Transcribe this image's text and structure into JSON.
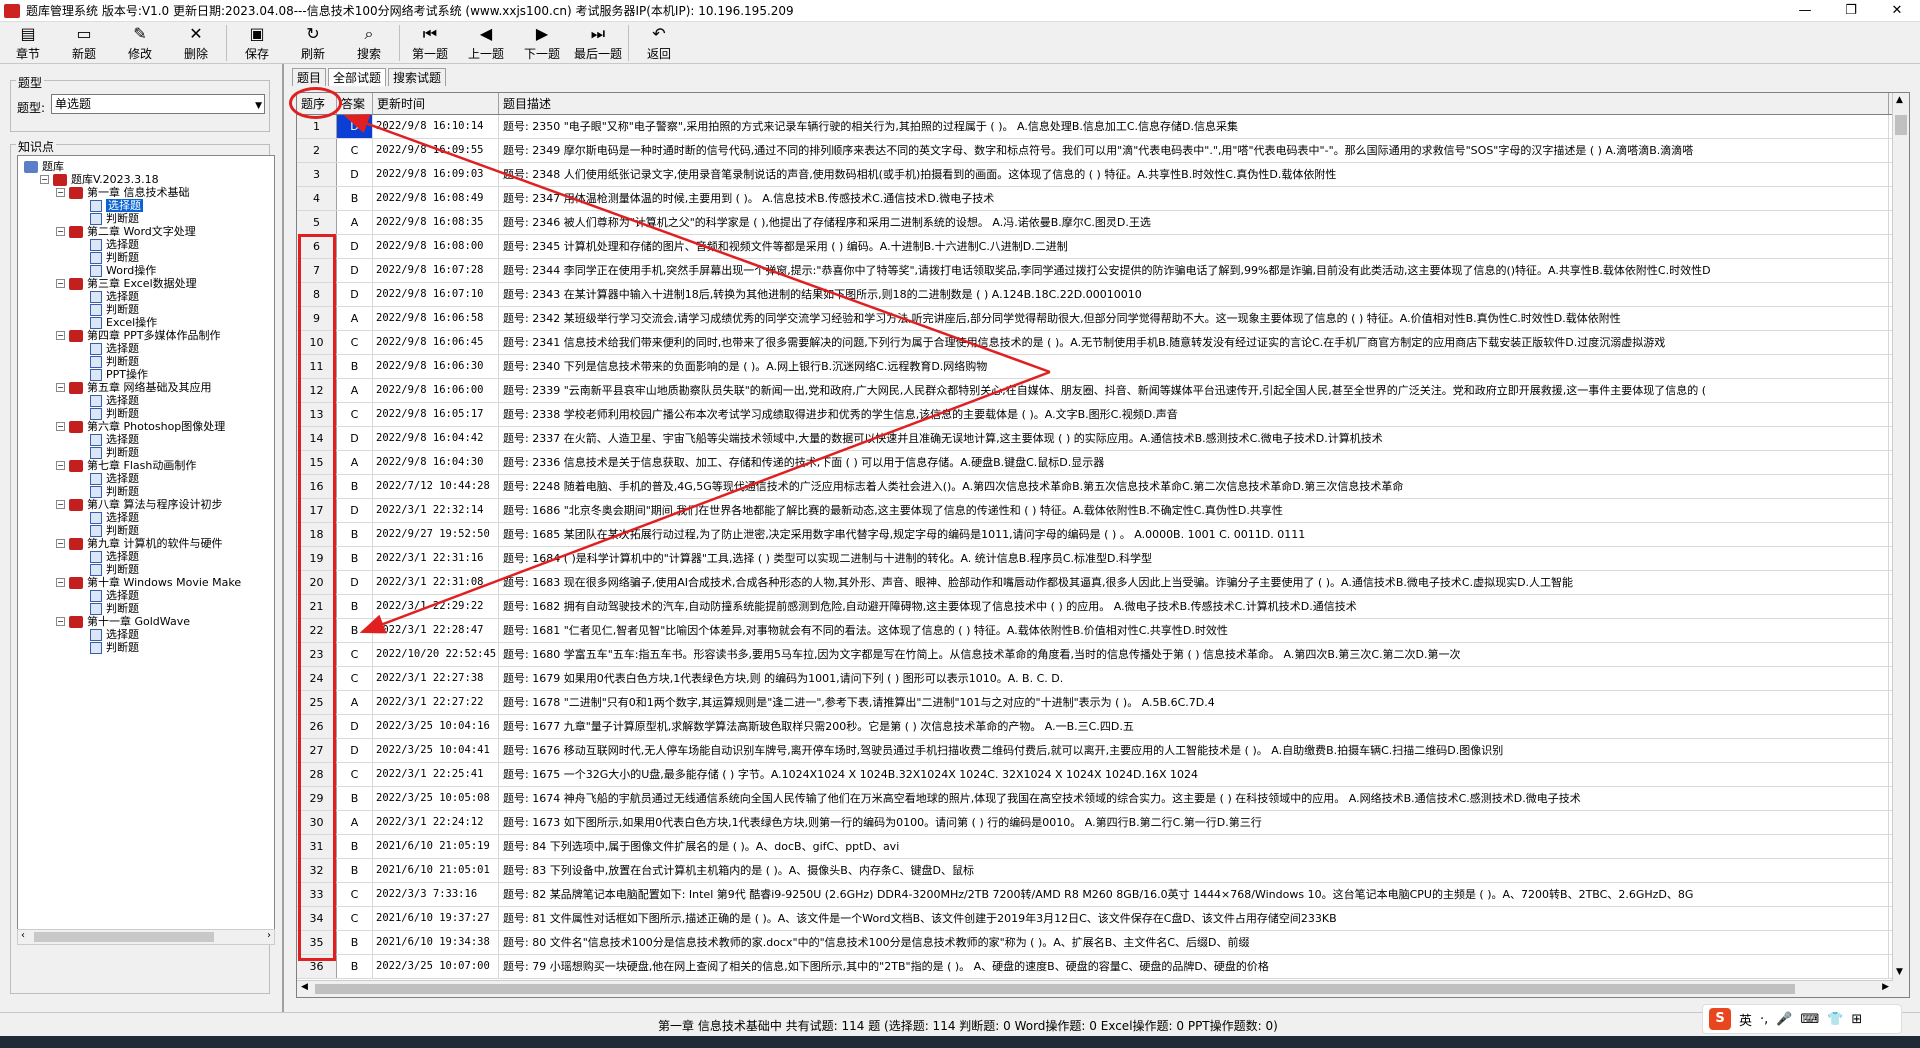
{
  "window": {
    "title": "题库管理系统 版本号:V1.0 更新日期:2023.04.08---信息技术100分网络考试系统    (www.xxjs100.cn)          考试服务器IP(本机IP): 10.196.195.209",
    "controls": [
      "—",
      "❐",
      "✕"
    ]
  },
  "toolbar": [
    {
      "label": "章节",
      "icon": "▤"
    },
    {
      "label": "新题",
      "icon": "▭"
    },
    {
      "label": "修改",
      "icon": "✎"
    },
    {
      "label": "删除",
      "icon": "✕"
    },
    {
      "label": "保存",
      "icon": "▣"
    },
    {
      "label": "刷新",
      "icon": "↻"
    },
    {
      "label": "搜索",
      "icon": "⌕"
    },
    {
      "label": "第一题",
      "icon": "⏮"
    },
    {
      "label": "上一题",
      "icon": "◀"
    },
    {
      "label": "下一题",
      "icon": "▶"
    },
    {
      "label": "最后一题",
      "icon": "⏭"
    },
    {
      "label": "返回",
      "icon": "↶"
    }
  ],
  "left": {
    "type_group": "题型",
    "type_label": "题型:",
    "type_value": "单选题",
    "kp_group": "知识点",
    "tree": [
      {
        "label": "题库",
        "level": 0,
        "kind": "root"
      },
      {
        "label": "题库V.2023.3.18",
        "level": 1,
        "kind": "book"
      },
      {
        "label": "第一章 信息技术基础",
        "level": 2,
        "kind": "book"
      },
      {
        "label": "选择题",
        "level": 3,
        "kind": "grid",
        "selected": true
      },
      {
        "label": "判断题",
        "level": 3,
        "kind": "grid"
      },
      {
        "label": "第二章 Word文字处理",
        "level": 2,
        "kind": "book"
      },
      {
        "label": "选择题",
        "level": 3,
        "kind": "grid"
      },
      {
        "label": "判断题",
        "level": 3,
        "kind": "grid"
      },
      {
        "label": "Word操作",
        "level": 3,
        "kind": "grid"
      },
      {
        "label": "第三章 Excel数据处理",
        "level": 2,
        "kind": "book"
      },
      {
        "label": "选择题",
        "level": 3,
        "kind": "grid"
      },
      {
        "label": "判断题",
        "level": 3,
        "kind": "grid"
      },
      {
        "label": "Excel操作",
        "level": 3,
        "kind": "grid"
      },
      {
        "label": "第四章 PPT多媒体作品制作",
        "level": 2,
        "kind": "book"
      },
      {
        "label": "选择题",
        "level": 3,
        "kind": "grid"
      },
      {
        "label": "判断题",
        "level": 3,
        "kind": "grid"
      },
      {
        "label": "PPT操作",
        "level": 3,
        "kind": "grid"
      },
      {
        "label": "第五章 网络基础及其应用",
        "level": 2,
        "kind": "book"
      },
      {
        "label": "选择题",
        "level": 3,
        "kind": "grid"
      },
      {
        "label": "判断题",
        "level": 3,
        "kind": "grid"
      },
      {
        "label": "第六章 Photoshop图像处理",
        "level": 2,
        "kind": "book"
      },
      {
        "label": "选择题",
        "level": 3,
        "kind": "grid"
      },
      {
        "label": "判断题",
        "level": 3,
        "kind": "grid"
      },
      {
        "label": "第七章 Flash动画制作",
        "level": 2,
        "kind": "book"
      },
      {
        "label": "选择题",
        "level": 3,
        "kind": "grid"
      },
      {
        "label": "判断题",
        "level": 3,
        "kind": "grid"
      },
      {
        "label": "第八章 算法与程序设计初步",
        "level": 2,
        "kind": "book"
      },
      {
        "label": "选择题",
        "level": 3,
        "kind": "grid"
      },
      {
        "label": "判断题",
        "level": 3,
        "kind": "grid"
      },
      {
        "label": "第九章 计算机的软件与硬件",
        "level": 2,
        "kind": "book"
      },
      {
        "label": "选择题",
        "level": 3,
        "kind": "grid"
      },
      {
        "label": "判断题",
        "level": 3,
        "kind": "grid"
      },
      {
        "label": "第十章 Windows Movie Make",
        "level": 2,
        "kind": "book"
      },
      {
        "label": "选择题",
        "level": 3,
        "kind": "grid"
      },
      {
        "label": "判断题",
        "level": 3,
        "kind": "grid"
      },
      {
        "label": "第十一章 GoldWave",
        "level": 2,
        "kind": "book"
      },
      {
        "label": "选择题",
        "level": 3,
        "kind": "grid"
      },
      {
        "label": "判断题",
        "level": 3,
        "kind": "grid"
      }
    ]
  },
  "tabs": [
    "题目",
    "全部试题",
    "搜索试题"
  ],
  "grid": {
    "headers": [
      "题序",
      "答案",
      "更新时间",
      "题目描述"
    ],
    "rows": [
      [
        "1",
        "D",
        "2022/9/8 16:10:14",
        "题号: 2350 \"电子眼\"又称\"电子警察\",采用拍照的方式来记录车辆行驶的相关行为,其拍照的过程属于 ( )。 A.信息处理B.信息加工C.信息存储D.信息采集"
      ],
      [
        "2",
        "C",
        "2022/9/8 16:09:55",
        "题号: 2349 摩尔斯电码是一种时通时断的信号代码,通过不同的排列顺序来表达不同的英文字母、数字和标点符号。我们可以用\"滴\"代表电码表中\".\",用\"嗒\"代表电码表中\"-\"。那么国际通用的求救信号\"SOS\"字母的汉字描述是 ( ) A.滴嗒滴B.滴滴嗒"
      ],
      [
        "3",
        "D",
        "2022/9/8 16:09:03",
        "题号: 2348 人们使用纸张记录文字,使用录音笔录制说话的声音,使用数码相机(或手机)拍摄看到的画面。这体现了信息的 ( ) 特征。A.共享性B.时效性C.真伪性D.载体依附性"
      ],
      [
        "4",
        "B",
        "2022/9/8 16:08:49",
        "题号: 2347 用体温枪测量体温的时候,主要用到 ( )。 A.信息技术B.传感技术C.通信技术D.微电子技术"
      ],
      [
        "5",
        "A",
        "2022/9/8 16:08:35",
        "题号: 2346 被人们尊称为\"计算机之父\"的科学家是 ( ),他提出了存储程序和采用二进制系统的设想。 A.冯.诺依曼B.摩尔C.图灵D.王选"
      ],
      [
        "6",
        "D",
        "2022/9/8 16:08:00",
        "题号: 2345 计算机处理和存储的图片、音频和视频文件等都是采用 ( ) 编码。A.十进制B.十六进制C.八进制D.二进制"
      ],
      [
        "7",
        "D",
        "2022/9/8 16:07:28",
        "题号: 2344 李同学正在使用手机,突然手屏幕出现一个弹窗,提示:\"恭喜你中了特等奖\",请拨打电话领取奖品,李同学通过拨打公安提供的防诈骗电话了解到,99%都是诈骗,目前没有此类活动,这主要体现了信息的()特征。A.共享性B.载体依附性C.时效性D"
      ],
      [
        "8",
        "D",
        "2022/9/8 16:07:10",
        "题号: 2343 在某计算器中输入十进制18后,转换为其他进制的结果如下图所示,则18的二进制数是 ( ) A.124B.18C.22D.00010010"
      ],
      [
        "9",
        "A",
        "2022/9/8 16:06:58",
        "题号: 2342 某班级举行学习交流会,请学习成绩优秀的同学交流学习经验和学习方法,听完讲座后,部分同学觉得帮助很大,但部分同学觉得帮助不大。这一现象主要体现了信息的 ( ) 特征。A.价值相对性B.真伪性C.时效性D.载体依附性"
      ],
      [
        "10",
        "C",
        "2022/9/8 16:06:45",
        "题号: 2341 信息技术给我们带来便利的同时,也带来了很多需要解决的问题,下列行为属于合理使用信息技术的是 ( )。A.无节制使用手机B.随意转发没有经过证实的言论C.在手机厂商官方制定的应用商店下载安装正版软件D.过度沉溺虚拟游戏"
      ],
      [
        "11",
        "B",
        "2022/9/8 16:06:30",
        "题号: 2340 下列是信息技术带来的负面影响的是 ( )。A.网上银行B.沉迷网络C.远程教育D.网络购物"
      ],
      [
        "12",
        "A",
        "2022/9/8 16:06:00",
        "题号: 2339 \"云南新平县哀牢山地质勘察队员失联\"的新闻一出,党和政府,广大网民,人民群众都特别关心,在自媒体、朋友圈、抖音、新闻等媒体平台迅速传开,引起全国人民,甚至全世界的广泛关注。党和政府立即开展救援,这一事件主要体现了信息的 ("
      ],
      [
        "13",
        "C",
        "2022/9/8 16:05:17",
        "题号: 2338 学校老师利用校园广播公布本次考试学习成绩取得进步和优秀的学生信息,该信息的主要载体是 ( )。A.文字B.图形C.视频D.声音"
      ],
      [
        "14",
        "D",
        "2022/9/8 16:04:42",
        "题号: 2337 在火箭、人造卫星、宇宙飞船等尖端技术领域中,大量的数据可以快速并且准确无误地计算,这主要体现 ( ) 的实际应用。A.通信技术B.感测技术C.微电子技术D.计算机技术"
      ],
      [
        "15",
        "A",
        "2022/9/8 16:04:30",
        "题号: 2336 信息技术是关于信息获取、加工、存储和传递的技术,下面 ( ) 可以用于信息存储。A.硬盘B.键盘C.鼠标D.显示器"
      ],
      [
        "16",
        "B",
        "2022/7/12 10:44:28",
        "题号: 2248 随着电脑、手机的普及,4G,5G等现代通信技术的广泛应用标志着人类社会进入()。A.第四次信息技术革命B.第五次信息技术革命C.第二次信息技术革命D.第三次信息技术革命"
      ],
      [
        "17",
        "D",
        "2022/3/1 22:32:14",
        "题号: 1686 \"北京冬奥会期间\"期间,我们在世界各地都能了解比赛的最新动态,这主要体现了信息的传递性和 ( ) 特征。A.载体依附性B.不确定性C.真伪性D.共享性"
      ],
      [
        "18",
        "B",
        "2022/9/27 19:52:50",
        "题号: 1685 某团队在某次拓展行动过程,为了防止泄密,决定采用数字串代替字母,规定字母的编码是1011,请问字母的编码是 ( ) 。 A.0000B. 1001 C. 0011D. 0111"
      ],
      [
        "19",
        "B",
        "2022/3/1 22:31:16",
        "题号: 1684 ( )是科学计算机中的\"计算器\"工具,选择 ( ) 类型可以实现二进制与十进制的转化。A. 统计信息B.程序员C.标准型D.科学型"
      ],
      [
        "20",
        "D",
        "2022/3/1 22:31:08",
        "题号: 1683 现在很多网络骗子,使用AI合成技术,合成各种形态的人物,其外形、声音、眼神、脸部动作和嘴唇动作都极其逼真,很多人因此上当受骗。诈骗分子主要使用了 ( )。A.通信技术B.微电子技术C.虚拟现实D.人工智能"
      ],
      [
        "21",
        "B",
        "2022/3/1 22:29:22",
        "题号: 1682 拥有自动驾驶技术的汽车,自动防撞系统能提前感测到危险,自动避开障碍物,这主要体现了信息技术中 ( ) 的应用。 A.微电子技术B.传感技术C.计算机技术D.通信技术"
      ],
      [
        "22",
        "B",
        "2022/3/1 22:28:47",
        "题号: 1681 \"仁者见仁,智者见智\"比喻因个体差异,对事物就会有不同的看法。这体现了信息的 ( ) 特征。A.载体依附性B.价值相对性C.共享性D.时效性"
      ],
      [
        "23",
        "C",
        "2022/10/20 22:52:45",
        "题号: 1680 学富五车\"五车:指五车书。形容读书多,要用5马车拉,因为文字都是写在竹简上。从信息技术革命的角度看,当时的信息传播处于第 ( ) 信息技术革命。 A.第四次B.第三次C.第二次D.第一次"
      ],
      [
        "24",
        "C",
        "2022/3/1 22:27:38",
        "题号: 1679 如果用0代表白色方块,1代表绿色方块,则 的编码为1001,请问下列 ( ) 图形可以表示1010。A. B. C. D."
      ],
      [
        "25",
        "A",
        "2022/3/1 22:27:22",
        "题号: 1678 \"二进制\"只有0和1两个数字,其运算规则是\"逢二进一\",参考下表,请推算出\"二进制\"101与之对应的\"十进制\"表示为 ( )。 A.5B.6C.7D.4"
      ],
      [
        "26",
        "D",
        "2022/3/25 10:04:16",
        "题号: 1677 九章\"量子计算原型机,求解数学算法高斯玻色取样只需200秒。它是第 ( ) 次信息技术革命的产物。 A.一B.三C.四D.五"
      ],
      [
        "27",
        "D",
        "2022/3/25 10:04:41",
        "题号: 1676 移动互联网时代,无人停车场能自动识别车牌号,离开停车场时,驾驶员通过手机扫描收费二维码付费后,就可以离开,主要应用的人工智能技术是 ( )。 A.自助缴费B.拍摄车辆C.扫描二维码D.图像识别"
      ],
      [
        "28",
        "C",
        "2022/3/1 22:25:41",
        "题号: 1675 一个32G大小的U盘,最多能存储 ( ) 字节。A.1024X1024 X 1024B.32X1024X 1024C. 32X1024 X 1024X 1024D.16X 1024"
      ],
      [
        "29",
        "B",
        "2022/3/25 10:05:08",
        "题号: 1674 神舟飞船的宇航员通过无线通信系统向全国人民传输了他们在万米高空看地球的照片,体现了我国在高空技术领域的综合实力。这主要是 ( ) 在科技领域中的应用。 A.网络技术B.通信技术C.感测技术D.微电子技术"
      ],
      [
        "30",
        "A",
        "2022/3/1 22:24:12",
        "题号: 1673 如下图所示,如果用0代表白色方块,1代表绿色方块,则第一行的编码为0100。请问第 ( ) 行的编码是0010。 A.第四行B.第二行C.第一行D.第三行"
      ],
      [
        "31",
        "B",
        "2021/6/10 21:05:19",
        "题号: 84 下列选项中,属于图像文件扩展名的是 ( )。A、docB、gifC、pptD、avi"
      ],
      [
        "32",
        "B",
        "2021/6/10 21:05:01",
        "题号: 83 下列设备中,放置在台式计算机主机箱内的是 ( )。A、摄像头B、内存条C、键盘D、鼠标"
      ],
      [
        "33",
        "C",
        "2022/3/3 7:33:16",
        "题号: 82 某品牌笔记本电脑配置如下: Intel 第9代 酷睿i9-9250U (2.6GHz) DDR4-3200MHz/2TB 7200转/AMD R8 M260 8GB/16.0英寸 1444×768/Windows 10。这台笔记本电脑CPU的主频是 ( )。A、7200转B、2TBC、2.6GHzD、8G"
      ],
      [
        "34",
        "C",
        "2021/6/10 19:37:27",
        "题号: 81 文件属性对话框如下图所示,描述正确的是 ( )。A、该文件是一个Word文档B、该文件创建于2019年3月12日C、该文件保存在C盘D、该文件占用存储空间233KB"
      ],
      [
        "35",
        "B",
        "2021/6/10 19:34:38",
        "题号: 80 文件名\"信息技术100分是信息技术教师的家.docx\"中的\"信息技术100分是信息技术教师的家\"称为 ( )。A、扩展名B、主文件名C、后缀D、前缀"
      ],
      [
        "36",
        "B",
        "2022/3/25 10:07:00",
        "题号: 79 小瑶想购买一块硬盘,他在网上查阅了相关的信息,如下图所示,其中的\"2TB\"指的是 ( )。 A、硬盘的速度B、硬盘的容量C、硬盘的品牌D、硬盘的价格"
      ]
    ]
  },
  "status": "第一章 信息技术基础中 共有试题: 114 题 (选择题: 114 判断题: 0 Word操作题: 0 Excel操作题: 0 PPT操作题数: 0)",
  "ime": {
    "logo": "S",
    "lang": "英"
  }
}
